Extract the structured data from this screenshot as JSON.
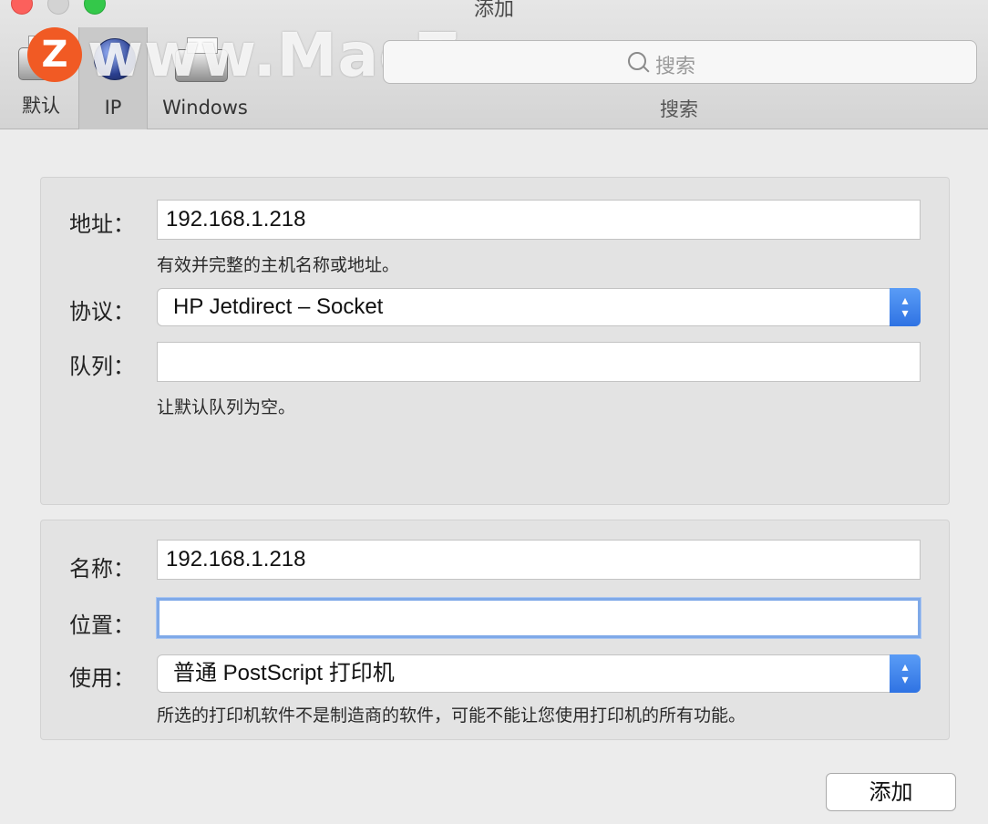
{
  "window": {
    "title": "添加"
  },
  "toolbar": {
    "items": [
      {
        "label": "默认",
        "icon": "printer-icon"
      },
      {
        "label": "IP",
        "icon": "globe-icon"
      },
      {
        "label": "Windows",
        "icon": "printer-icon"
      }
    ],
    "search": {
      "placeholder": "搜索",
      "label": "搜索"
    }
  },
  "watermark": {
    "logo": "Z",
    "text": "www.MacZ.com"
  },
  "connection": {
    "address": {
      "label": "地址：",
      "value": "192.168.1.218",
      "hint": "有效并完整的主机名称或地址。"
    },
    "protocol": {
      "label": "协议：",
      "value": "HP Jetdirect – Socket"
    },
    "queue": {
      "label": "队列：",
      "value": "",
      "hint": "让默认队列为空。"
    }
  },
  "printer": {
    "name": {
      "label": "名称：",
      "value": "192.168.1.218"
    },
    "location": {
      "label": "位置：",
      "value": ""
    },
    "use": {
      "label": "使用：",
      "value": "普通 PostScript 打印机",
      "hint": "所选的打印机软件不是制造商的软件，可能不能让您使用打印机的所有功能。"
    }
  },
  "actions": {
    "add_label": "添加"
  },
  "colors": {
    "accent": "#2f73e3",
    "focus": "#7fa9e8",
    "close": "#fc605c",
    "maximize": "#34c84a"
  }
}
